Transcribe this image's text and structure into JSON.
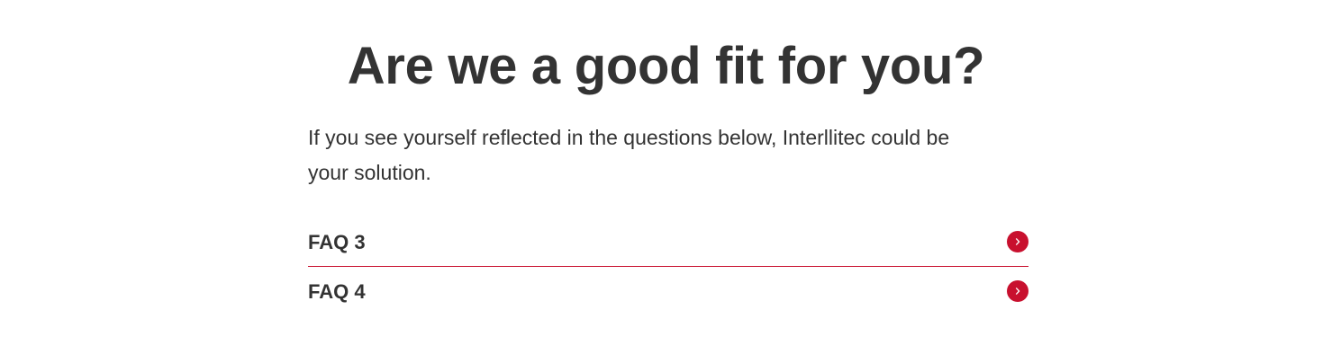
{
  "section": {
    "title": "Are we a good fit for you?",
    "intro": "If you see yourself reflected in the questions below, Interllitec could be your solution."
  },
  "faq": {
    "items": [
      {
        "label": "FAQ 3",
        "icon": "chevron-right-icon"
      },
      {
        "label": "FAQ 4",
        "icon": "chevron-right-icon"
      }
    ]
  },
  "colors": {
    "accent": "#c8102e",
    "text": "#333333",
    "background": "#ffffff"
  }
}
